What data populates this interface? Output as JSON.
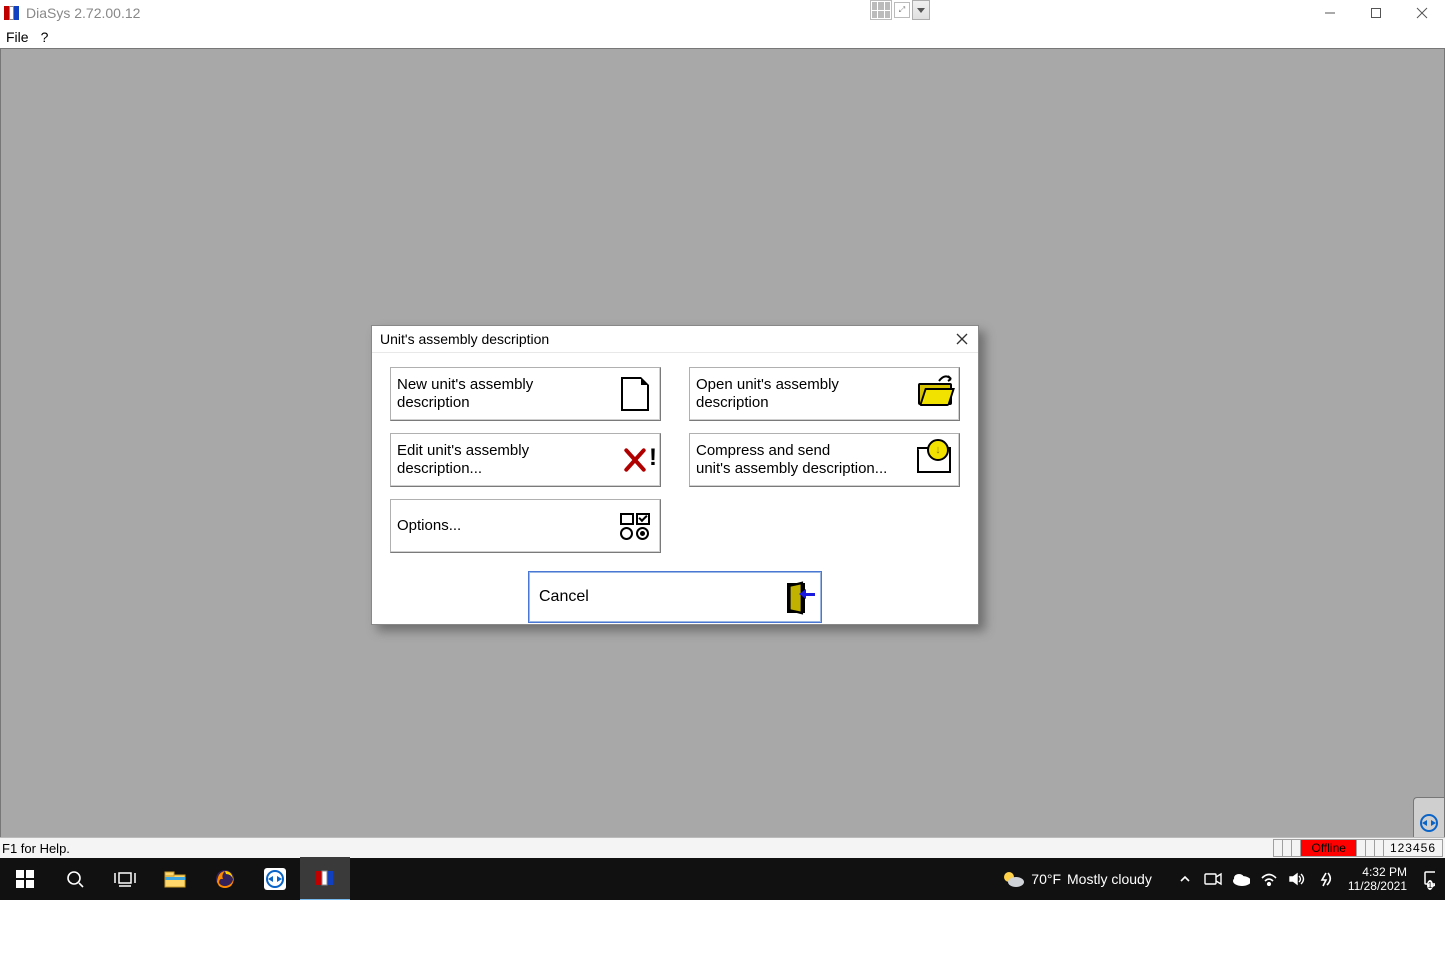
{
  "app": {
    "title": "DiaSys 2.72.00.12"
  },
  "menu": {
    "file": "File",
    "help": "?"
  },
  "dialog": {
    "title": "Unit's assembly description",
    "new": "New unit's assembly\ndescription",
    "open": "Open unit's assembly\ndescription",
    "edit": "Edit unit's assembly\ndescription...",
    "compress": "Compress and send\nunit's assembly description...",
    "options": "Options...",
    "cancel": "Cancel"
  },
  "statusbar": {
    "help": "F1 for Help.",
    "offline": "Offline",
    "code": "123456"
  },
  "taskbar": {
    "weather_temp": "70°F",
    "weather_desc": "Mostly cloudy",
    "time": "4:32 PM",
    "date": "11/28/2021"
  }
}
